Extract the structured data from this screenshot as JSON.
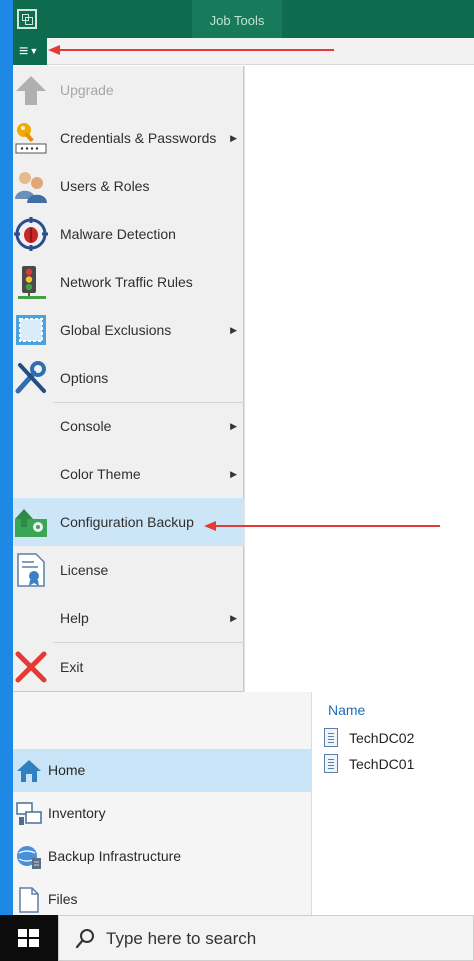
{
  "titlebar": {
    "job_tools_label": "Job Tools"
  },
  "main_menu": {
    "hamburger_icon": "hamburger-menu-icon",
    "items": [
      {
        "label": "Upgrade",
        "icon": "upgrade-arrow-icon",
        "disabled": true,
        "has_submenu": false
      },
      {
        "label": "Credentials & Passwords",
        "icon": "key-icon",
        "has_submenu": true
      },
      {
        "label": "Users & Roles",
        "icon": "users-icon",
        "has_submenu": false
      },
      {
        "label": "Malware Detection",
        "icon": "bug-target-icon",
        "has_submenu": false
      },
      {
        "label": "Network Traffic Rules",
        "icon": "traffic-light-icon",
        "has_submenu": false
      },
      {
        "label": "Global Exclusions",
        "icon": "exclusion-icon",
        "has_submenu": true
      },
      {
        "label": "Options",
        "icon": "tools-icon",
        "has_submenu": false
      },
      {
        "label": "Console",
        "icon": "",
        "has_submenu": true
      },
      {
        "label": "Color Theme",
        "icon": "",
        "has_submenu": true
      },
      {
        "label": "Configuration Backup",
        "icon": "config-backup-icon",
        "has_submenu": false,
        "selected": true
      },
      {
        "label": "License",
        "icon": "license-icon",
        "has_submenu": false
      },
      {
        "label": "Help",
        "icon": "",
        "has_submenu": true
      },
      {
        "label": "Exit",
        "icon": "exit-x-icon",
        "has_submenu": false
      }
    ]
  },
  "navigation": {
    "items": [
      {
        "label": "Home",
        "icon": "home-icon",
        "selected": true
      },
      {
        "label": "Inventory",
        "icon": "inventory-icon"
      },
      {
        "label": "Backup Infrastructure",
        "icon": "backup-infrastructure-icon"
      },
      {
        "label": "Files",
        "icon": "files-icon"
      }
    ]
  },
  "file_list": {
    "column_header": "Name",
    "rows": [
      {
        "name": "TechDC02",
        "icon": "document-icon"
      },
      {
        "name": "TechDC01",
        "icon": "document-icon"
      }
    ]
  },
  "taskbar": {
    "start_icon": "windows-logo-icon",
    "search_placeholder": "Type here to search"
  },
  "annotations": {
    "arrow_color": "#e53935"
  },
  "colors": {
    "title_green": "#0d6b4e",
    "selection_blue": "#cde6f7",
    "left_strip_blue": "#1e88e5"
  }
}
